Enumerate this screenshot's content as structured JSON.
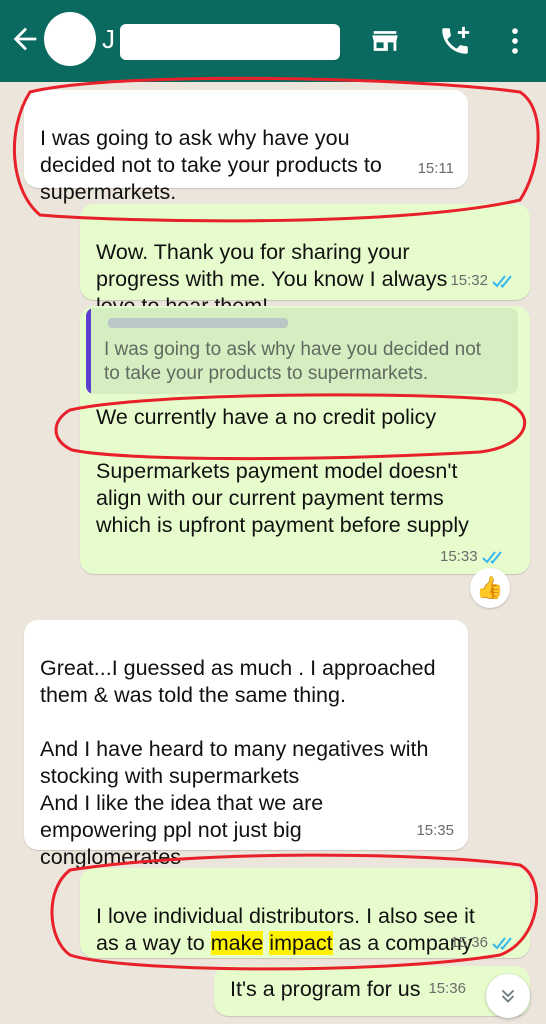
{
  "header": {
    "contact_initial": "J",
    "icons": [
      "back-arrow-icon",
      "shop-icon",
      "add-call-icon",
      "more-vert-icon"
    ]
  },
  "messages": {
    "m1": {
      "text": "I was going to ask why have you\ndecided not to take your products to\nsupermarkets.",
      "time": "15:11"
    },
    "m2": {
      "text": "Wow. Thank you for sharing your\nprogress with me. You know I always\nlove to hear them!",
      "time": "15:32"
    },
    "m3": {
      "quote_text": "I was going to ask why have you decided not\nto take your products to supermarkets.",
      "text": "We currently have a no credit policy\n\nSupermarkets payment model doesn't\nalign with our current payment terms\nwhich is upfront payment before supply",
      "time": "15:33",
      "reaction": "👍"
    },
    "m4": {
      "text": "Great...I guessed as much . I approached\nthem & was told the same thing.\n\nAnd I have heard to many negatives with\nstocking with supermarkets\nAnd I like the idea that we are\nempowering ppl not just big\nconglomerates",
      "time": "15:35"
    },
    "m5": {
      "line1": "I love individual distributors. I also see it",
      "pre": "as a way to ",
      "hl1": "make",
      "mid": " ",
      "hl2": "impact",
      "post": " as a company",
      "time": "15:36"
    },
    "m6": {
      "text": "It's a program for us",
      "time": "15:36"
    }
  },
  "colors": {
    "header": "#0a6a60",
    "chat_bg": "#ece5dc",
    "incoming": "#ffffff",
    "outgoing": "#e7fccd",
    "read_ticks": "#34b7f1",
    "annotation": "#e8202a",
    "highlight": "#fff200"
  }
}
